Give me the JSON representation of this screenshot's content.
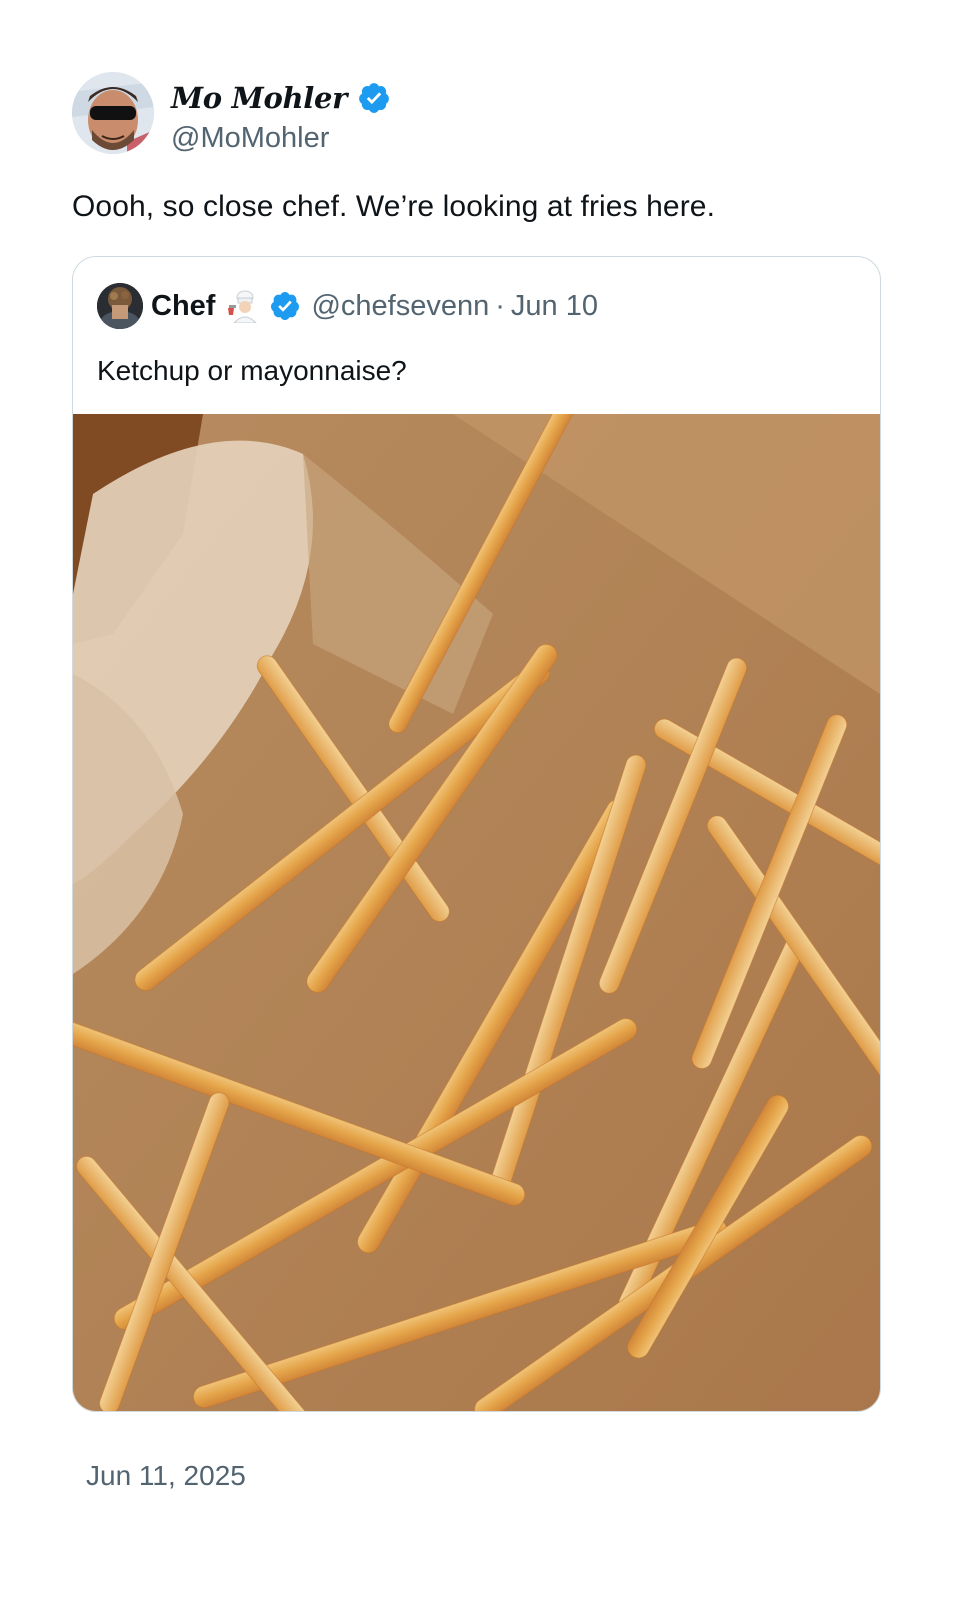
{
  "post": {
    "author_name": "Mo Mohler",
    "author_handle": "@MoMohler",
    "text": "Oooh, so close chef. We’re looking at fries here.",
    "date": "Jun 11, 2025",
    "verified": true
  },
  "quoted_post": {
    "author_name": "Chef",
    "author_handle": "@chefsevenn",
    "separator": "·",
    "date": "Jun 10",
    "text": "Ketchup or mayonnaise?",
    "verified": true,
    "emoji": "chef-emoji"
  },
  "colors": {
    "verified_blue": "#1d9bf0",
    "secondary_text": "#536471",
    "border": "#cfd9de"
  }
}
